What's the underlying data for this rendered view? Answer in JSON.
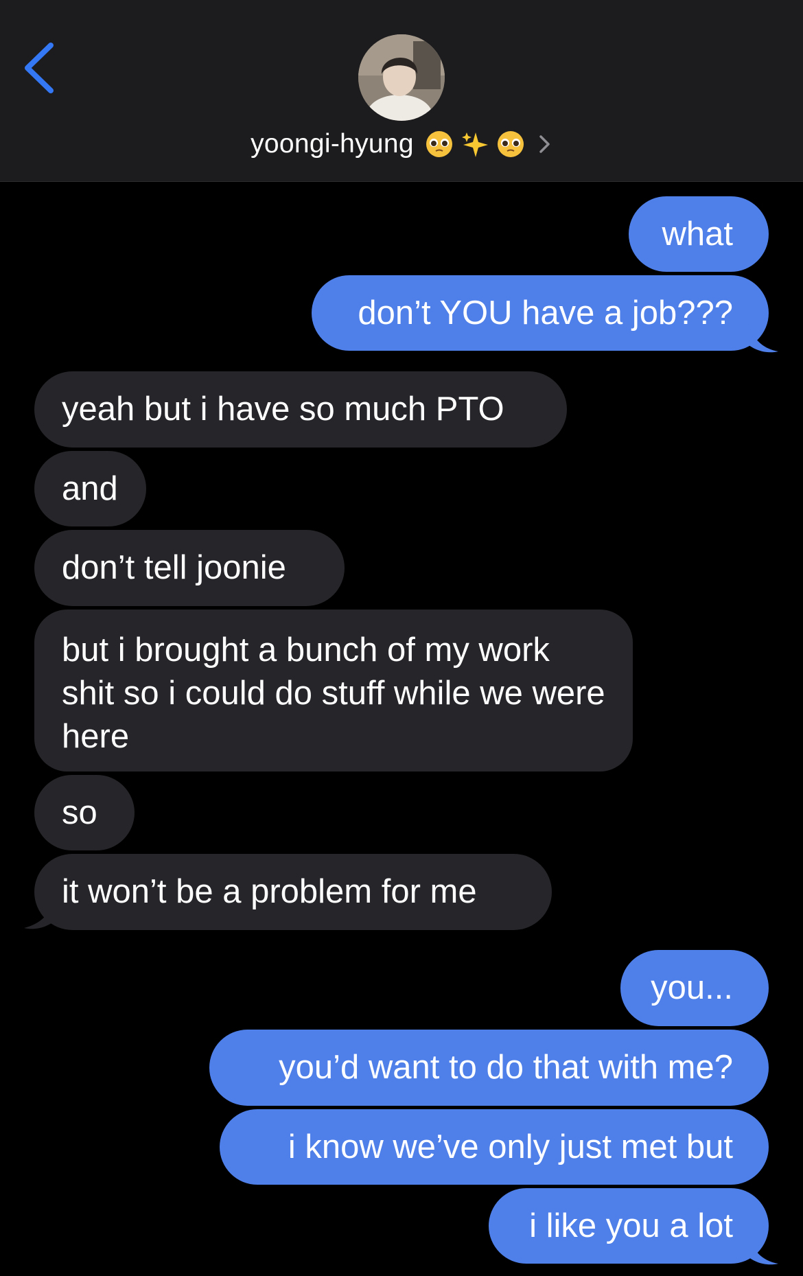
{
  "header": {
    "contact_name": "yoongi-hyung",
    "emojis": [
      "pleading-face",
      "sparkles",
      "pleading-face"
    ],
    "accent": "#3478f6"
  },
  "colors": {
    "outgoing_bubble": "#4f7fe8",
    "incoming_bubble": "#26262a",
    "background": "#000000",
    "header_bg": "#1c1c1e"
  },
  "messages": [
    {
      "from": "me",
      "text": "what"
    },
    {
      "from": "me",
      "text": "don’t YOU have a job???"
    },
    {
      "from": "them",
      "text": "yeah but i have so much PTO"
    },
    {
      "from": "them",
      "text": "and"
    },
    {
      "from": "them",
      "text": "don’t tell joonie"
    },
    {
      "from": "them",
      "text": "but i brought a bunch of my work shit so i could do stuff while we were here"
    },
    {
      "from": "them",
      "text": "so"
    },
    {
      "from": "them",
      "text": "it won’t be a problem for me"
    },
    {
      "from": "me",
      "text": "you..."
    },
    {
      "from": "me",
      "text": "you’d want to do that with me?"
    },
    {
      "from": "me",
      "text": "i know we’ve only just met but"
    },
    {
      "from": "me",
      "text": "i like you a lot"
    }
  ]
}
